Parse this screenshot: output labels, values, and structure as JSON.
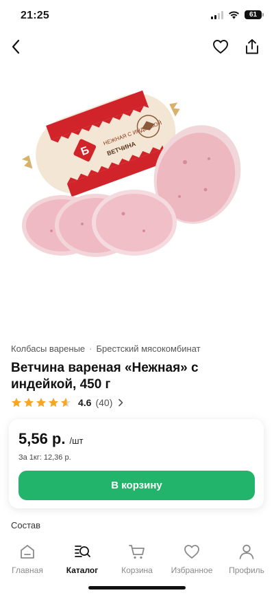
{
  "status": {
    "time": "21:25",
    "battery": "61"
  },
  "breadcrumbs": [
    "Колбасы вареные",
    "Брестский мясокомбинат"
  ],
  "product": {
    "title": "Ветчина вареная «Нежная» с индейкой, 450 г",
    "rating": "4.6",
    "reviews": "(40)",
    "stars_value": 4.6
  },
  "price": {
    "value": "5,56 р.",
    "unit": "/шт",
    "per_kg": "За 1кг: 12,36 р."
  },
  "cart_button": "В корзину",
  "section": "Состав",
  "tabs": [
    {
      "label": "Главная",
      "icon": "home-icon"
    },
    {
      "label": "Каталог",
      "icon": "catalog-search-icon"
    },
    {
      "label": "Корзина",
      "icon": "cart-icon"
    },
    {
      "label": "Избранное",
      "icon": "heart-icon"
    },
    {
      "label": "Профиль",
      "icon": "profile-icon"
    }
  ],
  "active_tab": "Каталог",
  "colors": {
    "accent": "#22b46a",
    "star": "#f5a623"
  },
  "product_package_text": [
    "Б",
    "НЕЖНАЯ С ИНДЕЙКОЙ",
    "ВЕТЧИНА"
  ]
}
